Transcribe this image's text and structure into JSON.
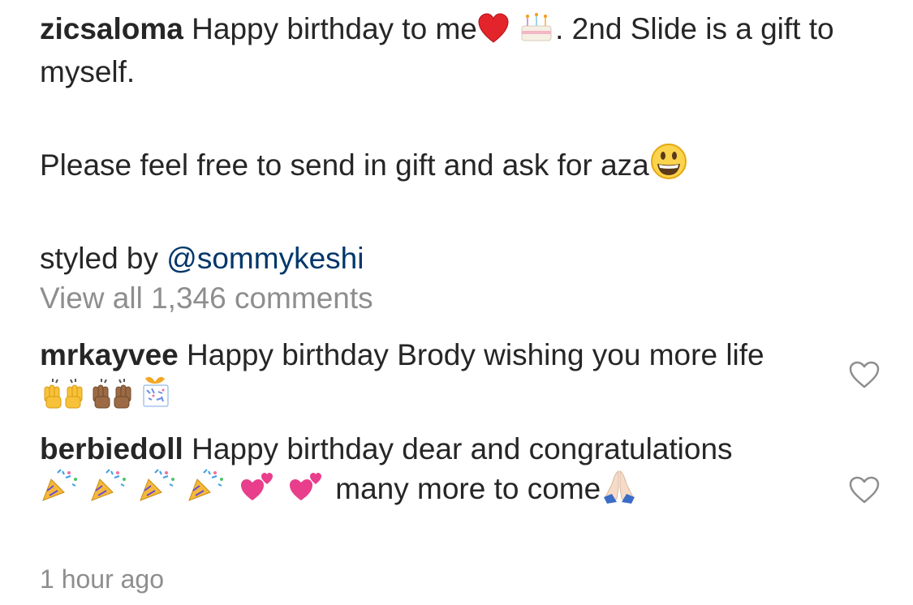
{
  "caption": {
    "username": "zicsaloma",
    "line1": "Happy birthday to me",
    "line1_after_emoji": ". 2nd Slide is a gift to myself.",
    "para2": "Please feel free to send in gift and ask for aza",
    "styled_by": "styled by ",
    "mention": "@sommykeshi",
    "emojis": [
      "red-heart-emoji",
      "birthday-cake-emoji",
      "grinning-face-emoji"
    ]
  },
  "view_all": "View all 1,346 comments",
  "comments": [
    {
      "username": "mrkayvee",
      "text": "Happy birthday Brody wishing you more life",
      "emojis": [
        "raising-hands-emoji",
        "raising-hands-dark-emoji",
        "wrapped-gift-emoji"
      ]
    },
    {
      "username": "berbiedoll",
      "text_a": "Happy birthday dear and congratulations",
      "text_b": "many more to come",
      "emojis": [
        "party-popper-emoji",
        "two-hearts-emoji",
        "folded-hands-emoji"
      ]
    }
  ],
  "timestamp": "1 hour ago",
  "colors": {
    "text": "#262626",
    "muted": "#8e8e8e",
    "mention": "#00376b"
  }
}
